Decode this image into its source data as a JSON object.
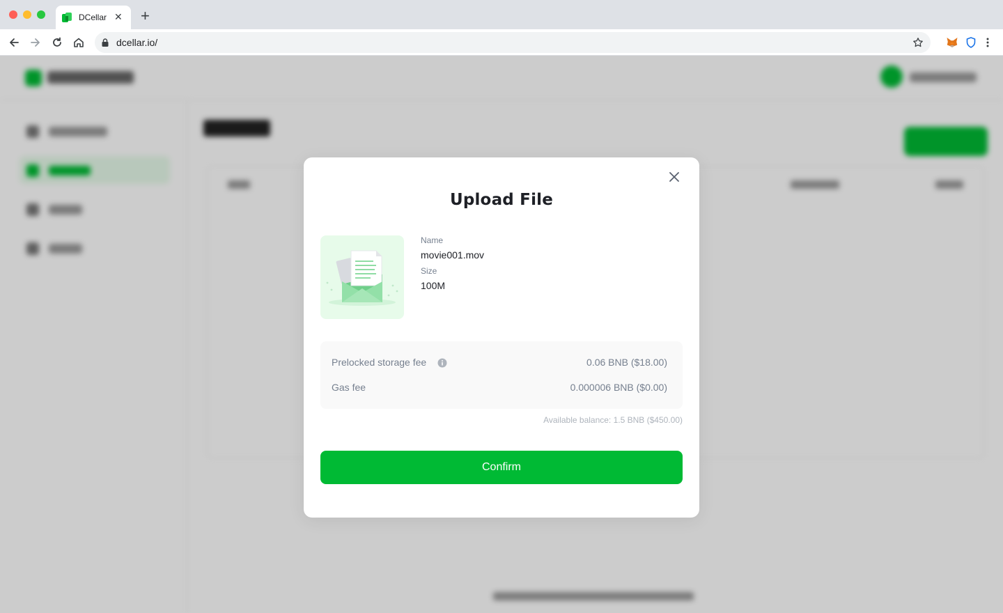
{
  "browser": {
    "tab_title": "DCellar",
    "tab_close": "✕",
    "new_tab": "+",
    "url": "dcellar.io/"
  },
  "modal": {
    "title": "Upload File",
    "file": {
      "name_label": "Name",
      "name": "movie001.mov",
      "size_label": "Size",
      "size": "100M"
    },
    "fees": [
      {
        "label": "Prelocked storage fee",
        "value": "0.06 BNB ($18.00)",
        "has_info_icon": true
      },
      {
        "label": "Gas fee",
        "value": "0.000006 BNB ($0.00)",
        "has_info_icon": false
      }
    ],
    "available_balance": "Available balance: 1.5 BNB ($450.00)",
    "confirm_label": "Confirm"
  },
  "colors": {
    "brand_green": "#00ba34",
    "thumb_bg": "#e7fbea",
    "muted_text": "#76808f"
  },
  "icons": [
    "back-arrow-icon",
    "forward-arrow-icon",
    "reload-icon",
    "home-icon",
    "lock-icon",
    "star-icon",
    "metamask-fox-icon",
    "shield-extension-icon",
    "more-menu-icon",
    "close-icon",
    "info-icon",
    "envelope-document-illustration"
  ]
}
